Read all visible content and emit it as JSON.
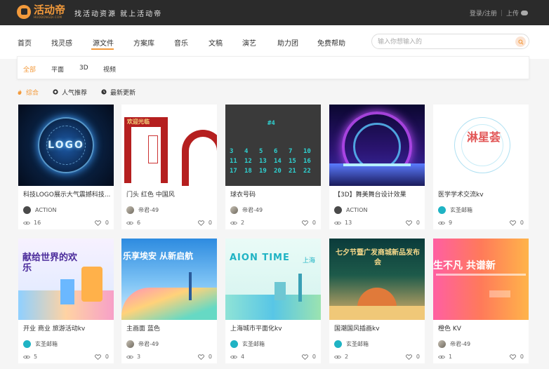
{
  "header": {
    "logo_cn": "活动帝",
    "logo_en": "HUODONGDI.COM",
    "slogan": "找活动资源 就上活动帝",
    "login": "登录/注册",
    "upload": "上传"
  },
  "nav": {
    "items": [
      "首页",
      "找灵感",
      "源文件",
      "方案库",
      "音乐",
      "文稿",
      "演艺",
      "助力团",
      "免费帮助"
    ],
    "active": "源文件"
  },
  "search": {
    "placeholder": "输入你想输入的"
  },
  "filters": {
    "items": [
      "全部",
      "平面",
      "3D",
      "视频"
    ],
    "active": "全部"
  },
  "sort": {
    "items": [
      "综合",
      "人气推荐",
      "最新更新"
    ],
    "active": "综合"
  },
  "colors": {
    "accent": "#f39a3b",
    "topbar": "#2b2b2b"
  },
  "cards": [
    {
      "title": "科技LOGO展示大气震撼科技...",
      "author": "ACTION",
      "views": "16",
      "likes": "0",
      "avatar": "gray",
      "icon": "logo-reveal-thumb"
    },
    {
      "title": "门头 红色 中国风",
      "author": "帝君-49",
      "views": "6",
      "likes": "0",
      "avatar": "photo",
      "icon": "red-gate-thumb"
    },
    {
      "title": "球衣号码",
      "author": "帝君-49",
      "views": "2",
      "likes": "0",
      "avatar": "photo",
      "icon": "jersey-numbers-thumb"
    },
    {
      "title": "【3D】舞美舞台设计效果",
      "author": "ACTION",
      "views": "13",
      "likes": "0",
      "avatar": "gray",
      "icon": "stage-design-thumb"
    },
    {
      "title": "医学学术交流kv",
      "author": "玄圣邮箱",
      "views": "9",
      "likes": "0",
      "avatar": "teal",
      "icon": "medical-kv-thumb"
    },
    {
      "title": "开业 商业 旅游活动kv",
      "author": "玄圣邮箱",
      "views": "5",
      "likes": "0",
      "avatar": "teal",
      "icon": "opening-kv-thumb"
    },
    {
      "title": "主画面 蓝色",
      "author": "帝君-49",
      "views": "3",
      "likes": "0",
      "avatar": "photo",
      "icon": "blue-kv-thumb"
    },
    {
      "title": "上海城市平面化kv",
      "author": "玄圣邮箱",
      "views": "4",
      "likes": "0",
      "avatar": "teal",
      "icon": "shanghai-kv-thumb"
    },
    {
      "title": "国潮国风插画kv",
      "author": "玄圣邮箱",
      "views": "2",
      "likes": "0",
      "avatar": "teal",
      "icon": "guochao-kv-thumb"
    },
    {
      "title": "橙色 KV",
      "author": "帝君-49",
      "views": "1",
      "likes": "0",
      "avatar": "photo",
      "icon": "orange-kv-thumb"
    }
  ],
  "thumb_text": {
    "logo": "LOGO",
    "gate": "欢迎光临",
    "jersey_top": "#4",
    "jersey_nums": [
      "3",
      "4",
      "5",
      "6",
      "7",
      "10",
      "11",
      "12",
      "13",
      "14",
      "15",
      "16",
      "17",
      "18",
      "19",
      "20",
      "21",
      "22"
    ],
    "medical": "淋星荟",
    "opening": "献给世界的欢乐",
    "blue": "乐享埃安 从新启航",
    "shanghai_logo": "AION TIME",
    "shanghai_sub": "上海",
    "guochao": "七夕节暨广发商城新品发布会",
    "orange": "生不凡 共谱新"
  }
}
